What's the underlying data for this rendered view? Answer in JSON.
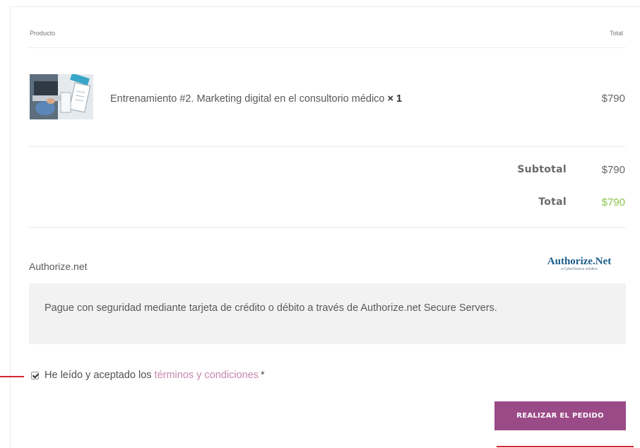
{
  "table": {
    "col_product": "Producto",
    "col_total": "Total"
  },
  "item": {
    "name": "Entrenamiento #2. Marketing digital en el consultorio médico",
    "quantity": "× 1",
    "price": "$790"
  },
  "summary": {
    "subtotal_label": "Subtotal",
    "subtotal_value": "$790",
    "total_label": "Total",
    "total_value": "$790"
  },
  "payment": {
    "method_label": "Authorize.net",
    "logo_text": "Authorize.Net",
    "logo_tagline": "a CyberSource solution",
    "description": "Pague con seguridad mediante tarjeta de crédito o débito a través de Authorize.net Secure Servers."
  },
  "terms": {
    "checked": true,
    "text": "He leído y aceptado los",
    "link_text": "términos y condiciones",
    "required_mark": "*"
  },
  "actions": {
    "place_order_label": "REALIZAR EL PEDIDO"
  },
  "colors": {
    "button": "#9b4a88",
    "link": "#c486ad",
    "total_value": "#8bc34a",
    "annotation": "#d4262f"
  }
}
